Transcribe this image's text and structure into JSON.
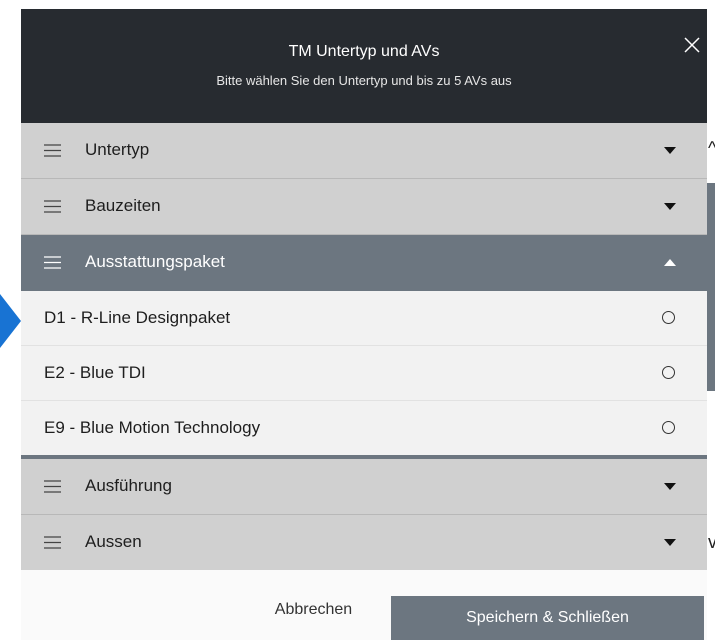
{
  "modal": {
    "title": "TM Untertyp und AVs",
    "subtitle": "Bitte wählen Sie den Untertyp und bis zu 5 AVs aus",
    "close_icon": "close-icon"
  },
  "sections": [
    {
      "label": "Untertyp",
      "expanded": false
    },
    {
      "label": "Bauzeiten",
      "expanded": false
    },
    {
      "label": "Ausstattungspaket",
      "expanded": true
    },
    {
      "label": "Ausführung",
      "expanded": false
    },
    {
      "label": "Aussen",
      "expanded": false
    }
  ],
  "options": [
    {
      "label": "D1 - R-Line Designpaket",
      "selected": false
    },
    {
      "label": "E2 - Blue TDI",
      "selected": false
    },
    {
      "label": "E9 - Blue Motion Technology",
      "selected": false
    }
  ],
  "footer": {
    "cancel_label": "Abbrechen",
    "save_label": "Speichern & Schließen"
  },
  "colors": {
    "header_bg": "#272b30",
    "section_bg": "#d0d0d0",
    "active_section_bg": "#6c7680",
    "option_bg": "#f2f2f2",
    "save_button_bg": "#6c7680",
    "accent_arrow": "#1873d3"
  }
}
